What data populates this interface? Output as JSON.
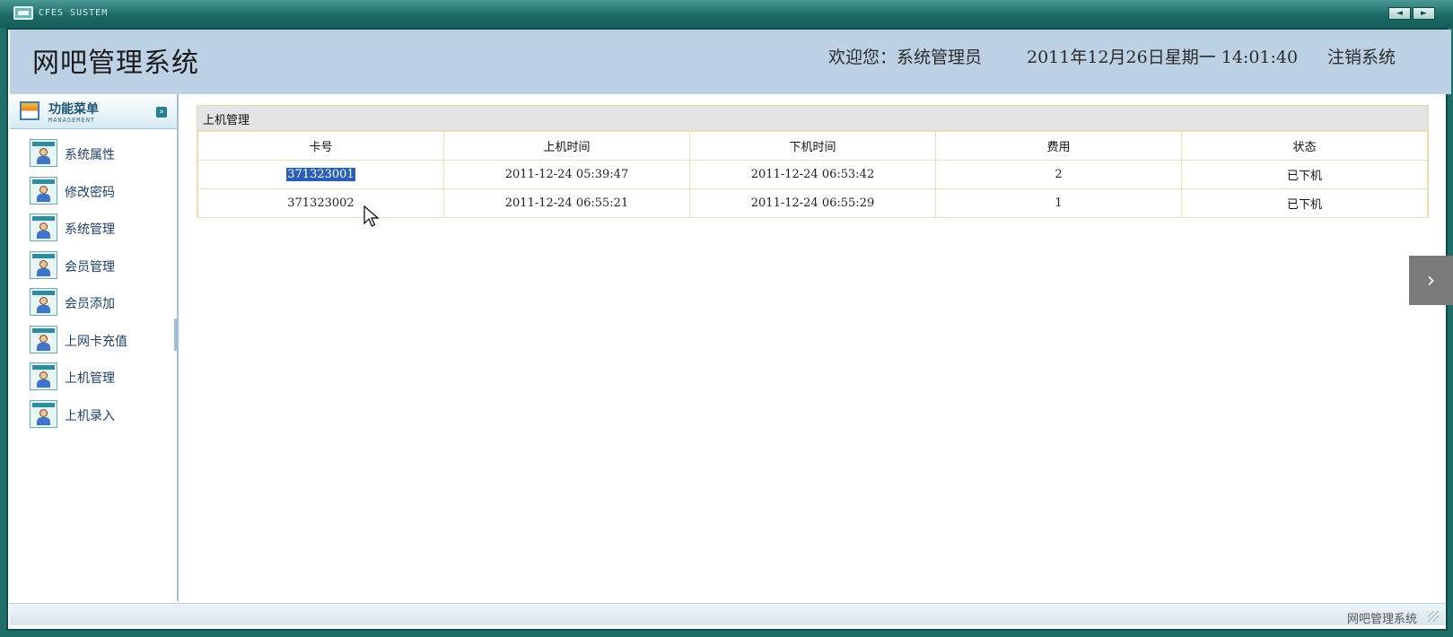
{
  "window": {
    "title": "CFES SUSTEM",
    "nav_prev": "◄",
    "nav_next": "►"
  },
  "header": {
    "app_title": "网吧管理系统",
    "welcome": "欢迎您：系统管理员",
    "datetime": "2011年12月26日星期一  14:01:40",
    "logout": "注销系统"
  },
  "sidebar": {
    "menu_title": "功能菜单",
    "menu_subtitle": "MANAGEMENT",
    "collapse_glyph": "»",
    "items": [
      {
        "label": "系统属性"
      },
      {
        "label": "修改密码"
      },
      {
        "label": "系统管理"
      },
      {
        "label": "会员管理"
      },
      {
        "label": "会员添加"
      },
      {
        "label": "上网卡充值"
      },
      {
        "label": "上机管理"
      },
      {
        "label": "上机录入"
      }
    ]
  },
  "panel": {
    "title": "上机管理",
    "columns": [
      "卡号",
      "上机时间",
      "下机时间",
      "费用",
      "状态"
    ],
    "rows": [
      {
        "card": "371323001",
        "start": "2011-12-24 05:39:47",
        "end": "2011-12-24 06:53:42",
        "fee": "2",
        "status": "已下机"
      },
      {
        "card": "371323002",
        "start": "2011-12-24 06:55:21",
        "end": "2011-12-24 06:55:29",
        "fee": "1",
        "status": "已下机"
      }
    ]
  },
  "side_tab": {
    "glyph": "›"
  },
  "footer": {
    "text": "网吧管理系统"
  },
  "colors": {
    "titlebar": "#1c6b66",
    "header_bg": "#bcd2e4",
    "selection": "#2a5fb4",
    "table_border": "#e6e2bd"
  }
}
